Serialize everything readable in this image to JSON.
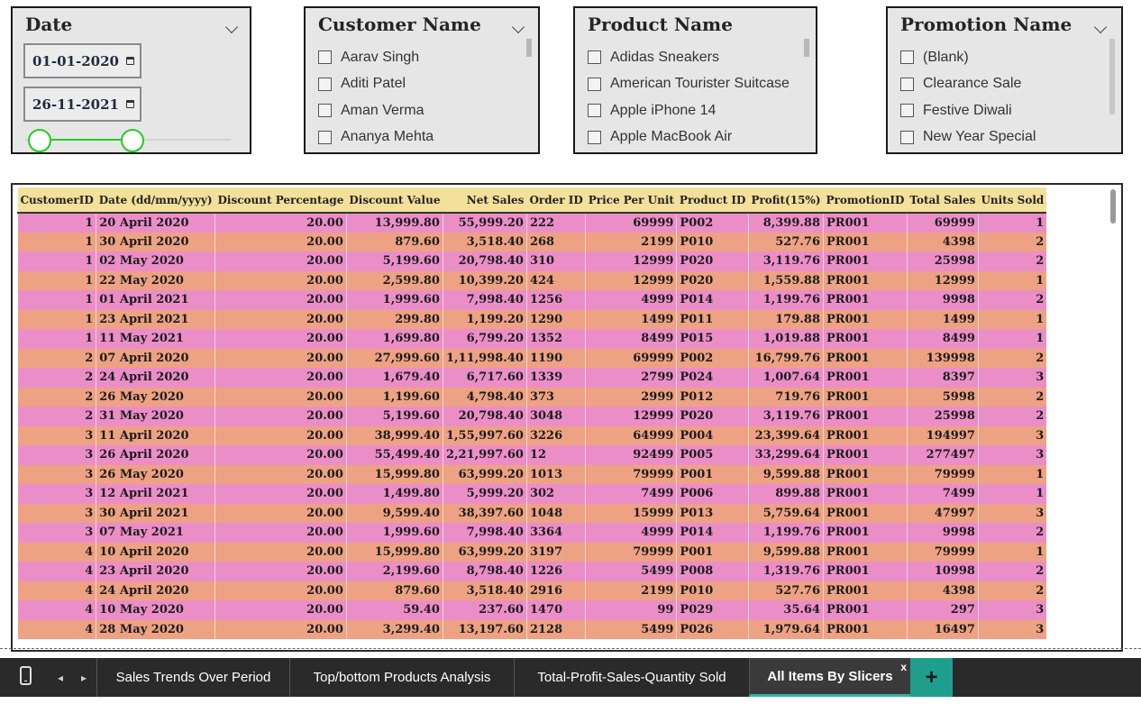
{
  "date_slicer": {
    "title": "Date",
    "start": "01-01-2020",
    "end": "26-11-2021",
    "range_fraction": [
      0.0,
      0.45
    ]
  },
  "customer_slicer": {
    "title": "Customer Name",
    "items": [
      "Aarav Singh",
      "Aditi Patel",
      "Aman Verma",
      "Ananya Mehta"
    ]
  },
  "product_slicer": {
    "title": "Product Name",
    "items": [
      "Adidas Sneakers",
      "American Tourister Suitcase",
      "Apple iPhone 14",
      "Apple MacBook Air"
    ]
  },
  "promotion_slicer": {
    "title": "Promotion Name",
    "items": [
      "(Blank)",
      "Clearance Sale",
      "Festive Diwali",
      "New Year Special"
    ]
  },
  "table": {
    "columns": [
      "CustomerID",
      "Date (dd/mm/yyyy)",
      "Discount Percentage",
      "Discount Value",
      "Net Sales",
      "Order ID",
      "Price Per Unit",
      "Product ID",
      "Profit(15%)",
      "PromotionID",
      "Total Sales",
      "Units Sold"
    ],
    "rows": [
      [
        "1",
        "20 April 2020",
        "20.00",
        "13,999.80",
        "55,999.20",
        "222",
        "69999",
        "P002",
        "8,399.88",
        "PR001",
        "69999",
        "1"
      ],
      [
        "1",
        "30 April 2020",
        "20.00",
        "879.60",
        "3,518.40",
        "268",
        "2199",
        "P010",
        "527.76",
        "PR001",
        "4398",
        "2"
      ],
      [
        "1",
        "02 May 2020",
        "20.00",
        "5,199.60",
        "20,798.40",
        "310",
        "12999",
        "P020",
        "3,119.76",
        "PR001",
        "25998",
        "2"
      ],
      [
        "1",
        "22 May 2020",
        "20.00",
        "2,599.80",
        "10,399.20",
        "424",
        "12999",
        "P020",
        "1,559.88",
        "PR001",
        "12999",
        "1"
      ],
      [
        "1",
        "01 April 2021",
        "20.00",
        "1,999.60",
        "7,998.40",
        "1256",
        "4999",
        "P014",
        "1,199.76",
        "PR001",
        "9998",
        "2"
      ],
      [
        "1",
        "23 April 2021",
        "20.00",
        "299.80",
        "1,199.20",
        "1290",
        "1499",
        "P011",
        "179.88",
        "PR001",
        "1499",
        "1"
      ],
      [
        "1",
        "11 May 2021",
        "20.00",
        "1,699.80",
        "6,799.20",
        "1352",
        "8499",
        "P015",
        "1,019.88",
        "PR001",
        "8499",
        "1"
      ],
      [
        "2",
        "07 April 2020",
        "20.00",
        "27,999.60",
        "1,11,998.40",
        "1190",
        "69999",
        "P002",
        "16,799.76",
        "PR001",
        "139998",
        "2"
      ],
      [
        "2",
        "24 April 2020",
        "20.00",
        "1,679.40",
        "6,717.60",
        "1339",
        "2799",
        "P024",
        "1,007.64",
        "PR001",
        "8397",
        "3"
      ],
      [
        "2",
        "26 May 2020",
        "20.00",
        "1,199.60",
        "4,798.40",
        "373",
        "2999",
        "P012",
        "719.76",
        "PR001",
        "5998",
        "2"
      ],
      [
        "2",
        "31 May 2020",
        "20.00",
        "5,199.60",
        "20,798.40",
        "3048",
        "12999",
        "P020",
        "3,119.76",
        "PR001",
        "25998",
        "2"
      ],
      [
        "3",
        "11 April 2020",
        "20.00",
        "38,999.40",
        "1,55,997.60",
        "3226",
        "64999",
        "P004",
        "23,399.64",
        "PR001",
        "194997",
        "3"
      ],
      [
        "3",
        "26 April 2020",
        "20.00",
        "55,499.40",
        "2,21,997.60",
        "12",
        "92499",
        "P005",
        "33,299.64",
        "PR001",
        "277497",
        "3"
      ],
      [
        "3",
        "26 May 2020",
        "20.00",
        "15,999.80",
        "63,999.20",
        "1013",
        "79999",
        "P001",
        "9,599.88",
        "PR001",
        "79999",
        "1"
      ],
      [
        "3",
        "12 April 2021",
        "20.00",
        "1,499.80",
        "5,999.20",
        "302",
        "7499",
        "P006",
        "899.88",
        "PR001",
        "7499",
        "1"
      ],
      [
        "3",
        "30 April 2021",
        "20.00",
        "9,599.40",
        "38,397.60",
        "1048",
        "15999",
        "P013",
        "5,759.64",
        "PR001",
        "47997",
        "3"
      ],
      [
        "3",
        "07 May 2021",
        "20.00",
        "1,999.60",
        "7,998.40",
        "3364",
        "4999",
        "P014",
        "1,199.76",
        "PR001",
        "9998",
        "2"
      ],
      [
        "4",
        "10 April 2020",
        "20.00",
        "15,999.80",
        "63,999.20",
        "3197",
        "79999",
        "P001",
        "9,599.88",
        "PR001",
        "79999",
        "1"
      ],
      [
        "4",
        "23 April 2020",
        "20.00",
        "2,199.60",
        "8,798.40",
        "1226",
        "5499",
        "P008",
        "1,319.76",
        "PR001",
        "10998",
        "2"
      ],
      [
        "4",
        "24 April 2020",
        "20.00",
        "879.60",
        "3,518.40",
        "2916",
        "2199",
        "P010",
        "527.76",
        "PR001",
        "4398",
        "2"
      ],
      [
        "4",
        "10 May 2020",
        "20.00",
        "59.40",
        "237.60",
        "1470",
        "99",
        "P029",
        "35.64",
        "PR001",
        "297",
        "3"
      ],
      [
        "4",
        "28 May 2020",
        "20.00",
        "3,299.40",
        "13,197.60",
        "2128",
        "5499",
        "P026",
        "1,979.64",
        "PR001",
        "16497",
        "3"
      ]
    ]
  },
  "tabs": {
    "pages": [
      "Sales Trends Over Period",
      "Top/bottom Products Analysis",
      "Total-Profit-Sales-Quantity Sold",
      "All Items By Slicers"
    ],
    "active_index": 3,
    "close_label": "x",
    "add_label": "+",
    "prev_icon": "◂",
    "next_icon": "▸"
  },
  "colors": {
    "row_pink": "#eb8ec8",
    "row_orange": "#eda283",
    "header": "#f3e09a",
    "slider": "#22cc22",
    "add_tab": "#1f9e8e"
  }
}
